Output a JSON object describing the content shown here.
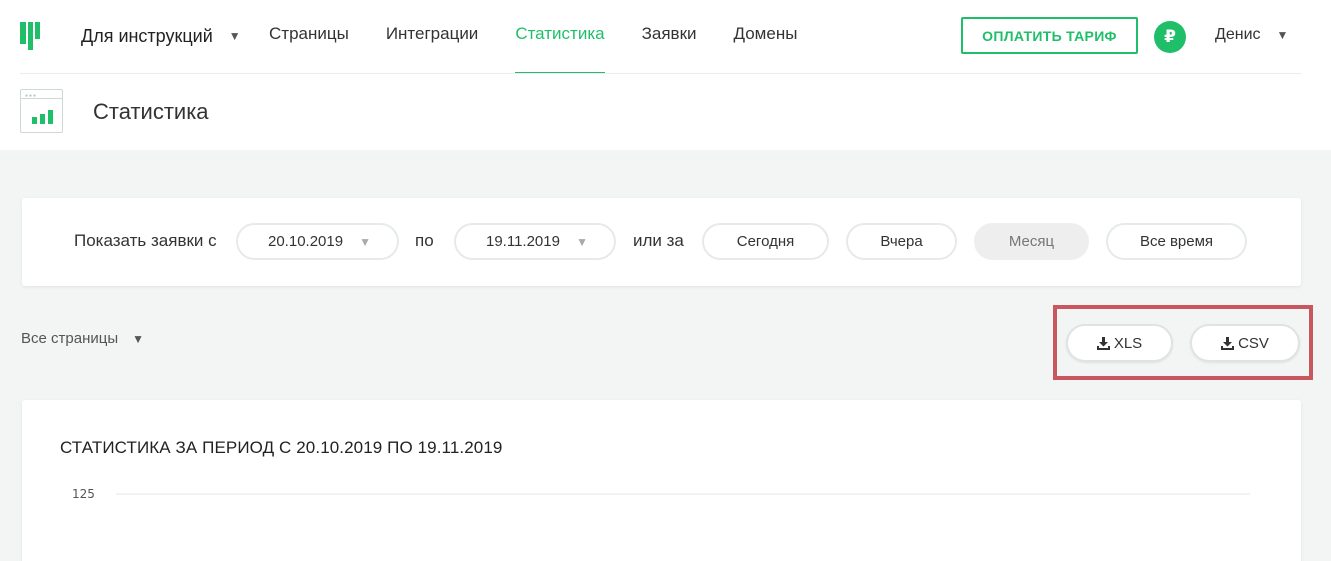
{
  "header": {
    "project_name": "Для инструкций",
    "nav": [
      {
        "label": "Страницы",
        "active": false
      },
      {
        "label": "Интеграции",
        "active": false
      },
      {
        "label": "Статистика",
        "active": true
      },
      {
        "label": "Заявки",
        "active": false
      },
      {
        "label": "Домены",
        "active": false
      }
    ],
    "pay_button": "ОПЛАТИТЬ ТАРИФ",
    "currency_symbol": "₽",
    "user_name": "Денис",
    "accent_color": "#1fbf6a"
  },
  "page": {
    "title": "Статистика",
    "icon": "statistics-icon"
  },
  "filter": {
    "show_from_label": "Показать заявки с",
    "date_from": "20.10.2019",
    "to_label": "по",
    "date_to": "19.11.2019",
    "or_label": "или за",
    "ranges": [
      {
        "label": "Сегодня",
        "active": false
      },
      {
        "label": "Вчера",
        "active": false
      },
      {
        "label": "Месяц",
        "active": true
      },
      {
        "label": "Все время",
        "active": false
      }
    ]
  },
  "pages_filter": {
    "selected": "Все страницы"
  },
  "export": {
    "xls_label": "XLS",
    "csv_label": "CSV",
    "icon": "download-icon",
    "highlight_color": "#c9575f"
  },
  "chart_data": {
    "type": "line",
    "title": "СТАТИСТИКА ЗА ПЕРИОД С 20.10.2019 ПО 19.11.2019",
    "xlabel": "",
    "ylabel": "",
    "y_ticks": [
      125
    ],
    "series": []
  }
}
